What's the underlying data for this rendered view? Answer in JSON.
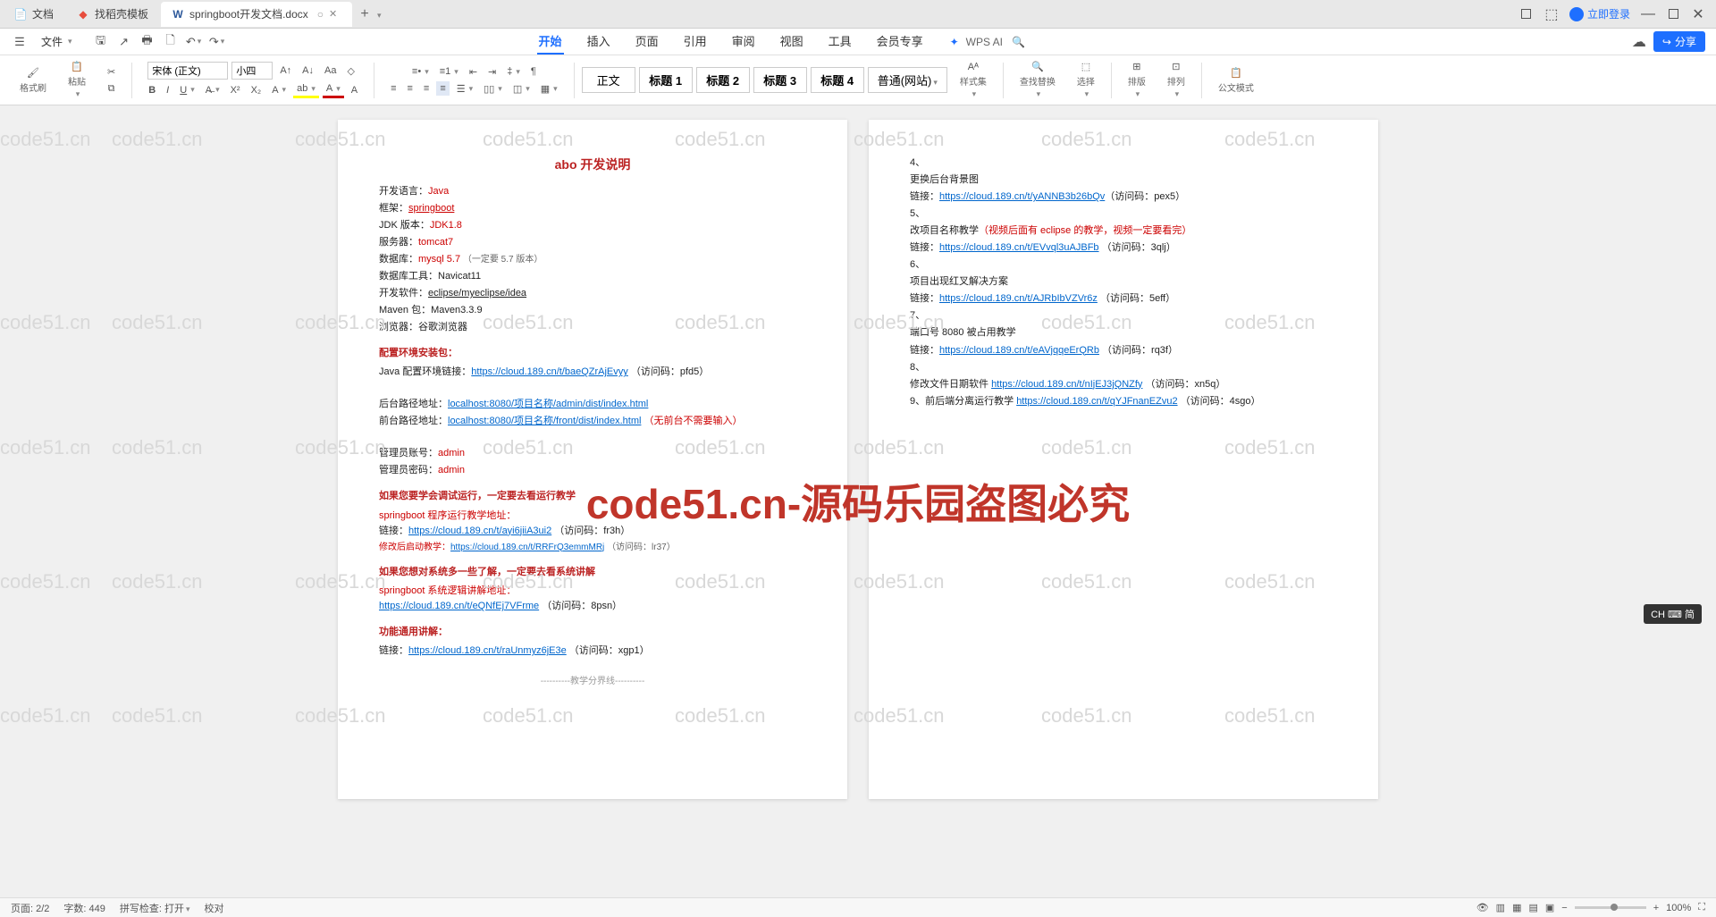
{
  "tabs": [
    {
      "label": "文档",
      "icon": "doc"
    },
    {
      "label": "找稻壳模板",
      "icon": "rice"
    },
    {
      "label": "springboot开发文档.docx",
      "icon": "word",
      "active": true
    }
  ],
  "window": {
    "login": "立即登录"
  },
  "file_menu": "文件",
  "menu_tabs": [
    "开始",
    "插入",
    "页面",
    "引用",
    "审阅",
    "视图",
    "工具",
    "会员专享"
  ],
  "active_menu": "开始",
  "wpsai": "WPS AI",
  "share": "分享",
  "ribbon": {
    "format_painter": "格式刷",
    "paste": "粘贴",
    "font_name": "宋体 (正文)",
    "font_size": "小四",
    "styles": [
      "正文",
      "标题 1",
      "标题 2",
      "标题 3",
      "标题 4",
      "普通(网站)"
    ],
    "style_set": "样式集",
    "find_replace": "查找替换",
    "select": "选择",
    "sort": "排版",
    "align": "排列",
    "official": "公文模式"
  },
  "doc": {
    "title": "abo 开发说明",
    "lines1": [
      {
        "k": "开发语言：",
        "v": "Java",
        "red": true
      },
      {
        "k": "框架：",
        "v": "springboot",
        "red": true,
        "u": true
      },
      {
        "k": "JDK 版本：",
        "v": "JDK1.8",
        "red": true
      },
      {
        "k": "服务器：",
        "v": "tomcat7",
        "red": true
      },
      {
        "k": "数据库：",
        "v": "mysql 5.7",
        "red": true,
        "note": "（一定要 5.7 版本）"
      },
      {
        "k": "数据库工具：",
        "v": "Navicat11"
      },
      {
        "k": "开发软件：",
        "v": "eclipse/myeclipse/idea",
        "u": true
      },
      {
        "k": "Maven 包：",
        "v": "Maven3.3.9"
      },
      {
        "k": "浏览器：",
        "v": "谷歌浏览器"
      }
    ],
    "sec_env": "配置环境安装包：",
    "env_line": "Java 配置环境链接：",
    "env_url": "https://cloud.189.cn/t/baeQZrAjEvyy",
    "env_code": "（访问码：pfd5）",
    "back_path": "后台路径地址：",
    "back_url": "localhost:8080/项目名称/admin/dist/index.html",
    "front_path": "前台路径地址：",
    "front_url": "localhost:8080/项目名称/front/dist/index.html",
    "front_note": "（无前台不需要输入）",
    "admin_user": "管理员账号：",
    "admin_user_v": "admin",
    "admin_pwd": "管理员密码：",
    "admin_pwd_v": "admin",
    "sec_run": "如果您要学会调试运行，一定要去看运行教学",
    "run_sub": "springboot 程序运行教学地址：",
    "run_url": "https://cloud.189.cn/t/ayi6jiiA3ui2",
    "run_code": "（访问码：fr3h）",
    "mod_lbl": "修改后启动教学：",
    "mod_url": "https://cloud.189.cn/t/RRFrQ3emmMRj",
    "mod_code": "（访问码：lr37）",
    "sec_sys": "如果您想对系统多一些了解，一定要去看系统讲解",
    "sys_sub": "springboot 系统逻辑讲解地址：",
    "sys_url": "https://cloud.189.cn/t/eQNfEj7VFrme",
    "sys_code": "（访问码：8psn）",
    "sec_func": "功能通用讲解：",
    "func_url": "https://cloud.189.cn/t/raUnmyz6jE3e",
    "func_code": "（访问码：xgp1）",
    "divider": "教学分界线"
  },
  "doc2": {
    "i4": "4、",
    "i4_t": "更换后台背景图",
    "i4_l": "链接：",
    "i4_u": "https://cloud.189.cn/t/yANNB3b26bQv",
    "i4_c": "（访问码：pex5）",
    "i5": "5、",
    "i5_t": "改项目名称教学",
    "i5_n": "（视频后面有 eclipse 的教学，视频一定要看完）",
    "i5_l": "链接：",
    "i5_u": "https://cloud.189.cn/t/EVvql3uAJBFb",
    "i5_c": "（访问码：3qlj）",
    "i6": "6、",
    "i6_t": "项目出现红叉解决方案",
    "i6_l": "链接：",
    "i6_u": "https://cloud.189.cn/t/AJRbIbVZVr6z",
    "i6_c": "（访问码：5eff）",
    "i7": "7、",
    "i7_t": "端口号 8080 被占用教学",
    "i7_l": "链接：",
    "i7_u": "https://cloud.189.cn/t/eAVjqqeErQRb",
    "i7_c": "（访问码：rq3f）",
    "i8": "8、",
    "i8_t": "修改文件日期软件",
    "i8_u": "https://cloud.189.cn/t/nIjEJ3jQNZfy",
    "i8_c": "（访问码：xn5q）",
    "i9": "9、前后端分离运行教学",
    "i9_u": "https://cloud.189.cn/t/qYJFnanEZvu2",
    "i9_c": "（访问码：4sgo）"
  },
  "status": {
    "page": "页面: 2/2",
    "words": "字数: 449",
    "spell": "拼写检查: 打开",
    "proof": "校对",
    "zoom": "100%"
  },
  "watermark_text": "code51.cn",
  "big_watermark": "code51.cn-源码乐园盗图必究",
  "ime": "CH ⌨ 简"
}
